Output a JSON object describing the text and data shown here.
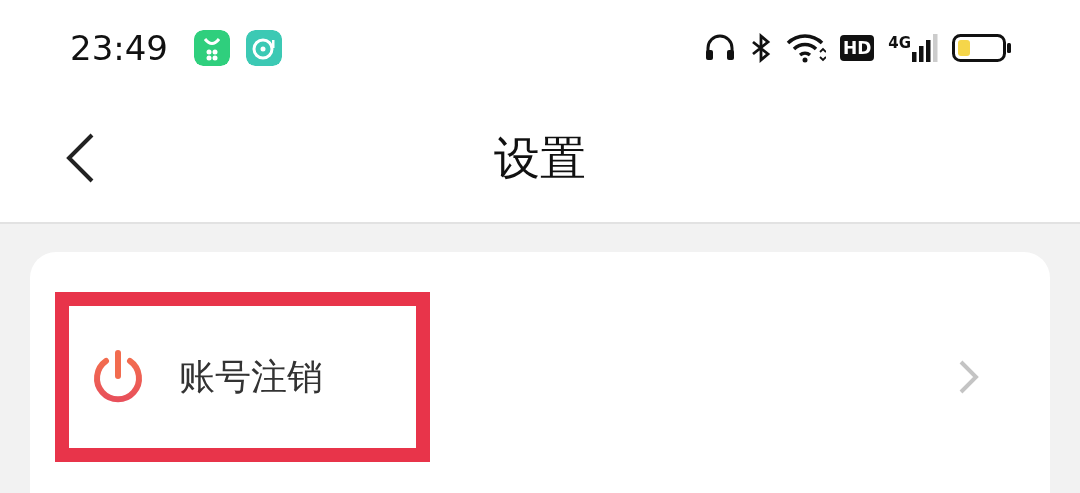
{
  "status_bar": {
    "time": "23:49",
    "hd_badge": "HD",
    "network": "4G"
  },
  "header": {
    "title": "设置"
  },
  "settings": [
    {
      "label": "账号注销",
      "highlighted": true
    }
  ]
}
